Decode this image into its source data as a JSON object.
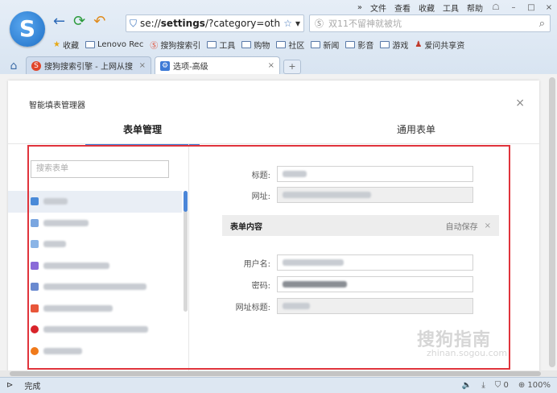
{
  "menubar": {
    "chevron": "»",
    "items": [
      "文件",
      "查看",
      "收藏",
      "工具",
      "帮助"
    ]
  },
  "address": {
    "url_prefix": "se://",
    "url_bold": "settings",
    "url_rest": "/?category=oth"
  },
  "search": {
    "placeholder": "双11不留神就被坑"
  },
  "bookmarks": {
    "items": [
      "收藏",
      "Lenovo Rec",
      "搜狗搜索引",
      "工具",
      "购物",
      "社区",
      "新闻",
      "影音",
      "游戏",
      "爱问共享资"
    ]
  },
  "tabs": [
    {
      "label": "搜狗搜索引擎 - 上网从搜",
      "active": false
    },
    {
      "label": "选项-高级",
      "active": true
    }
  ],
  "panel": {
    "title": "智能填表管理器",
    "tab_forms": "表单管理",
    "tab_general": "通用表单",
    "search_placeholder": "搜索表单"
  },
  "form": {
    "title_label": "标题:",
    "url_label": "网址:",
    "section_title": "表单内容",
    "autosave": "自动保存",
    "username_label": "用户名:",
    "password_label": "密码:",
    "page_title_label": "网址标题:"
  },
  "watermark": {
    "text": "搜狗指南",
    "sub": "zhinan.sogou.com"
  },
  "status": {
    "text": "完成",
    "zoom": "100%",
    "count": "0"
  },
  "colors": {
    "accent": "#3d7ad6",
    "highlight_box": "#e0343c"
  }
}
